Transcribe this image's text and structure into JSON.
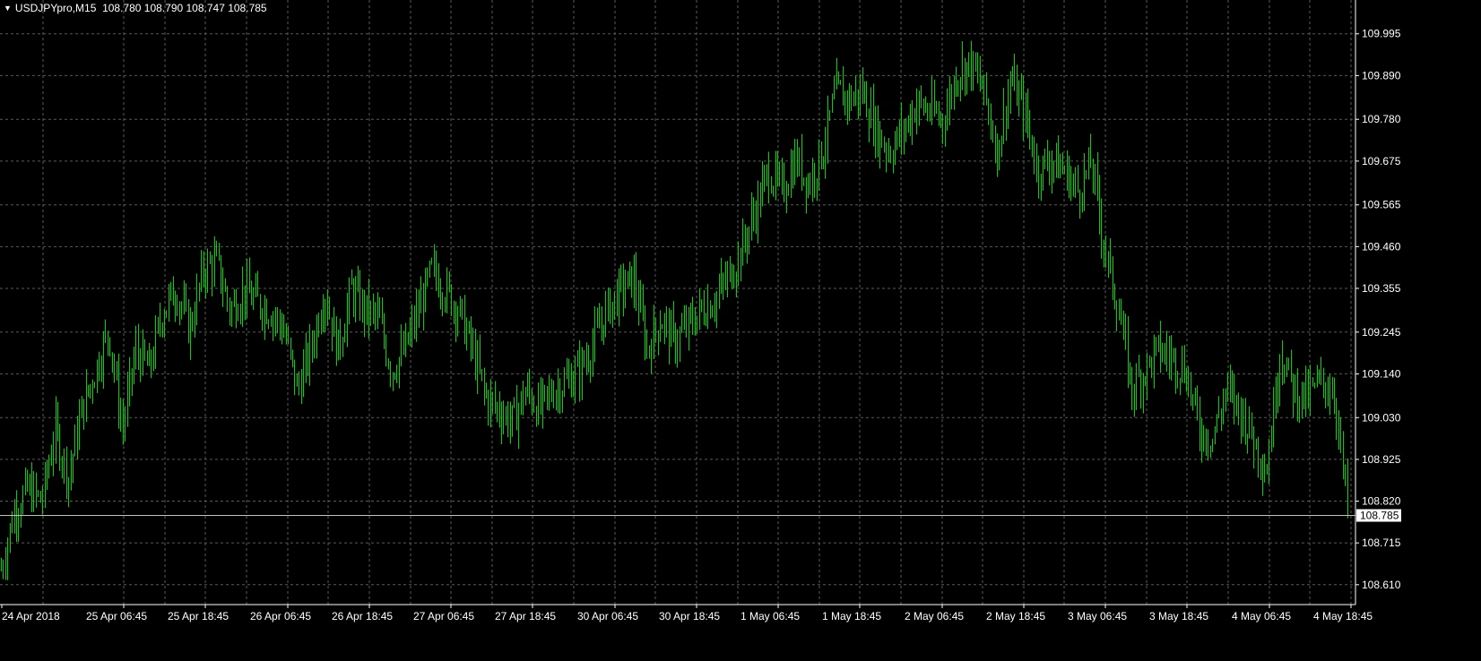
{
  "header": {
    "symbol": "USDJPYpro,M15",
    "ohlc": "108.780 108.790 108.747 108.785"
  },
  "colors": {
    "background": "#000000",
    "grid": "#5a5a5a",
    "bar": "#00d400",
    "text": "#ffffff",
    "current_line": "#c0c0c0"
  },
  "chart_data": {
    "type": "ohlc-bar",
    "timeframe": "M15",
    "grid": true,
    "ylim": [
      108.56,
      110.08
    ],
    "y_ticks": [
      "109.995",
      "109.890",
      "109.780",
      "109.675",
      "109.565",
      "109.460",
      "109.355",
      "109.245",
      "109.140",
      "109.030",
      "108.925",
      "108.820",
      "108.715",
      "108.610"
    ],
    "x_ticks": [
      "24 Apr 2018",
      "25 Apr 06:45",
      "25 Apr 18:45",
      "26 Apr 06:45",
      "26 Apr 18:45",
      "27 Apr 06:45",
      "27 Apr 18:45",
      "30 Apr 06:45",
      "30 Apr 18:45",
      "1 May 06:45",
      "1 May 18:45",
      "2 May 06:45",
      "2 May 18:45",
      "3 May 06:45",
      "3 May 18:45",
      "4 May 06:45",
      "4 May 18:45"
    ],
    "current_price": "108.785",
    "price_path": [
      [
        0,
        108.65
      ],
      [
        3,
        108.8
      ],
      [
        6,
        108.85
      ],
      [
        9,
        108.82
      ],
      [
        12,
        109.0
      ],
      [
        15,
        108.88
      ],
      [
        18,
        109.05
      ],
      [
        21,
        109.15
      ],
      [
        24,
        109.25
      ],
      [
        27,
        109.0
      ],
      [
        30,
        109.2
      ],
      [
        33,
        109.15
      ],
      [
        36,
        109.3
      ],
      [
        39,
        109.35
      ],
      [
        42,
        109.25
      ],
      [
        45,
        109.4
      ],
      [
        48,
        109.42
      ],
      [
        51,
        109.3
      ],
      [
        54,
        109.35
      ],
      [
        57,
        109.32
      ],
      [
        60,
        109.3
      ],
      [
        63,
        109.25
      ],
      [
        66,
        109.1
      ],
      [
        69,
        109.2
      ],
      [
        72,
        109.35
      ],
      [
        75,
        109.2
      ],
      [
        78,
        109.35
      ],
      [
        81,
        109.3
      ],
      [
        84,
        109.28
      ],
      [
        87,
        109.15
      ],
      [
        90,
        109.2
      ],
      [
        93,
        109.3
      ],
      [
        96,
        109.4
      ],
      [
        99,
        109.35
      ],
      [
        102,
        109.3
      ],
      [
        105,
        109.2
      ],
      [
        108,
        109.08
      ],
      [
        111,
        109.05
      ],
      [
        114,
        109.02
      ],
      [
        117,
        109.1
      ],
      [
        120,
        109.05
      ],
      [
        123,
        109.1
      ],
      [
        126,
        109.12
      ],
      [
        129,
        109.15
      ],
      [
        132,
        109.22
      ],
      [
        135,
        109.3
      ],
      [
        138,
        109.35
      ],
      [
        141,
        109.38
      ],
      [
        144,
        109.2
      ],
      [
        147,
        109.28
      ],
      [
        150,
        109.22
      ],
      [
        153,
        109.26
      ],
      [
        156,
        109.3
      ],
      [
        159,
        109.33
      ],
      [
        162,
        109.38
      ],
      [
        165,
        109.45
      ],
      [
        168,
        109.55
      ],
      [
        171,
        109.65
      ],
      [
        174,
        109.6
      ],
      [
        177,
        109.68
      ],
      [
        180,
        109.62
      ],
      [
        183,
        109.7
      ],
      [
        186,
        109.85
      ],
      [
        189,
        109.83
      ],
      [
        192,
        109.85
      ],
      [
        195,
        109.75
      ],
      [
        198,
        109.7
      ],
      [
        201,
        109.75
      ],
      [
        204,
        109.82
      ],
      [
        207,
        109.8
      ],
      [
        210,
        109.78
      ],
      [
        213,
        109.9
      ],
      [
        216,
        109.92
      ],
      [
        219,
        109.85
      ],
      [
        222,
        109.7
      ],
      [
        225,
        109.88
      ],
      [
        228,
        109.8
      ],
      [
        231,
        109.65
      ],
      [
        234,
        109.68
      ],
      [
        237,
        109.65
      ],
      [
        240,
        109.6
      ],
      [
        243,
        109.67
      ],
      [
        246,
        109.45
      ],
      [
        249,
        109.3
      ],
      [
        252,
        109.1
      ],
      [
        255,
        109.15
      ],
      [
        258,
        109.2
      ],
      [
        261,
        109.18
      ],
      [
        264,
        109.15
      ],
      [
        267,
        109.0
      ],
      [
        270,
        108.98
      ],
      [
        273,
        109.1
      ],
      [
        276,
        109.05
      ],
      [
        279,
        108.98
      ],
      [
        282,
        108.9
      ],
      [
        285,
        109.2
      ],
      [
        288,
        109.1
      ],
      [
        291,
        109.08
      ],
      [
        294,
        109.12
      ],
      [
        297,
        109.1
      ],
      [
        300,
        108.8
      ]
    ]
  }
}
